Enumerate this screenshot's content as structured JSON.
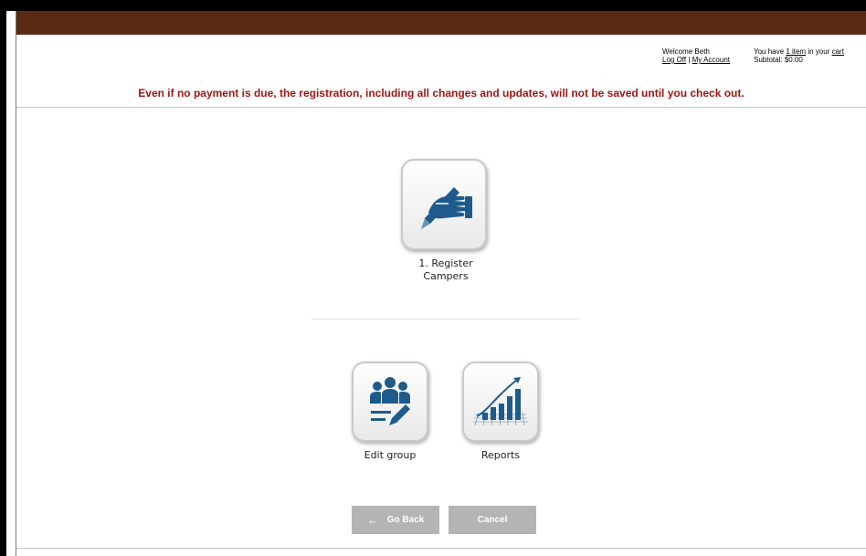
{
  "header": {
    "welcome_text": "Welcome Beth",
    "logoff_label": "Log Off",
    "separator": "|",
    "my_account_label": "My Account",
    "cart_prefix": "You have",
    "cart_item_link": "1 item",
    "cart_middle": "in your",
    "cart_link": "cart",
    "subtotal_label": "Subtotal:",
    "subtotal_value": "$0.00"
  },
  "warning_message": "Even if no payment is due, the registration, including all changes and updates, will not be saved until you check out.",
  "tiles": {
    "register": {
      "line1": "1. Register",
      "line2": "Campers",
      "icon": "hand-writing-icon"
    },
    "edit_group": {
      "label": "Edit group",
      "icon": "group-edit-icon"
    },
    "reports": {
      "label": "Reports",
      "icon": "bar-chart-growth-icon"
    }
  },
  "buttons": {
    "go_back": "Go Back",
    "go_back_icon": "←",
    "cancel": "Cancel"
  },
  "colors": {
    "header_bar": "#5a2a12",
    "warning_text": "#a31515",
    "icon_blue": "#1e5b8c",
    "button_gray": "#b4b4b4"
  }
}
